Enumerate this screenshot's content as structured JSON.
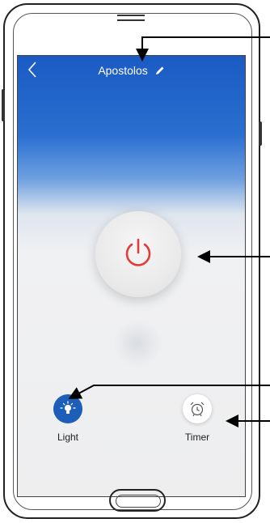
{
  "header": {
    "title": "Apostolos",
    "back_icon": "chevron-left-icon",
    "edit_icon": "pencil-icon"
  },
  "main": {
    "power_icon": "power-icon",
    "power_color": "#e23b3b"
  },
  "controls": [
    {
      "label": "Light",
      "icon": "lightbulb-icon",
      "color": "#1d5fb8"
    },
    {
      "label": "Timer",
      "icon": "alarm-clock-icon",
      "color": "#ffffff"
    }
  ],
  "colors": {
    "header_blue": "#1a5bc4",
    "background": "#eeeeef"
  }
}
